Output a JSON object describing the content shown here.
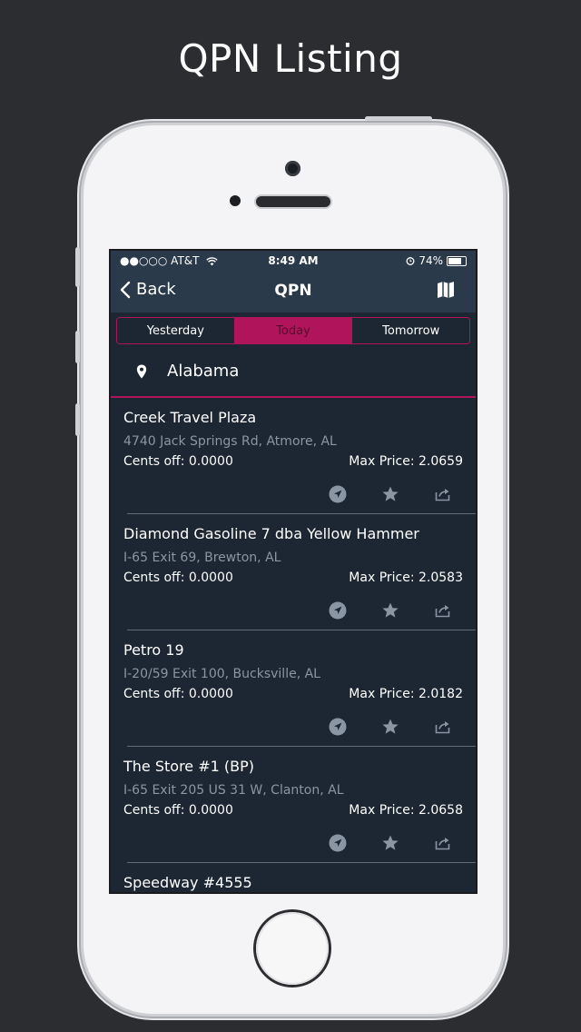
{
  "headline": "QPN Listing",
  "status_bar": {
    "carrier": "●●○○○ AT&T",
    "time": "8:49 AM",
    "battery": "74%"
  },
  "nav": {
    "back_label": "Back",
    "title": "QPN"
  },
  "segments": [
    {
      "label": "Yesterday",
      "selected": false
    },
    {
      "label": "Today",
      "selected": true
    },
    {
      "label": "Tomorrow",
      "selected": false
    }
  ],
  "location": {
    "state": "Alabama"
  },
  "listings": [
    {
      "name": "Creek Travel Plaza",
      "address": "4740 Jack Springs Rd, Atmore, AL",
      "cents_off": "Cents off: 0.0000",
      "max_price": "Max Price: 2.0659"
    },
    {
      "name": "Diamond Gasoline 7 dba Yellow Hammer",
      "address": "I-65 Exit 69, Brewton, AL",
      "cents_off": "Cents off: 0.0000",
      "max_price": "Max Price: 2.0583"
    },
    {
      "name": "Petro 19",
      "address": "I-20/59 Exit 100, Bucksville, AL",
      "cents_off": "Cents off: 0.0000",
      "max_price": "Max Price: 2.0182"
    },
    {
      "name": "The Store #1 (BP)",
      "address": "I-65 Exit 205 US 31 W, Clanton, AL",
      "cents_off": "Cents off: 0.0000",
      "max_price": "Max Price: 2.0658"
    },
    {
      "name": "Speedway #4555"
    }
  ],
  "colors": {
    "accent": "#b0145a",
    "screen_bg": "#1c2733",
    "nav_bg": "#2a3a4a",
    "page_bg": "#2b2d30"
  },
  "icons": {
    "back": "chevron-left-icon",
    "map": "map-icon",
    "pin": "location-pin-icon",
    "navigate": "navigate-arrow-icon",
    "favorite": "star-icon",
    "share": "share-icon"
  }
}
